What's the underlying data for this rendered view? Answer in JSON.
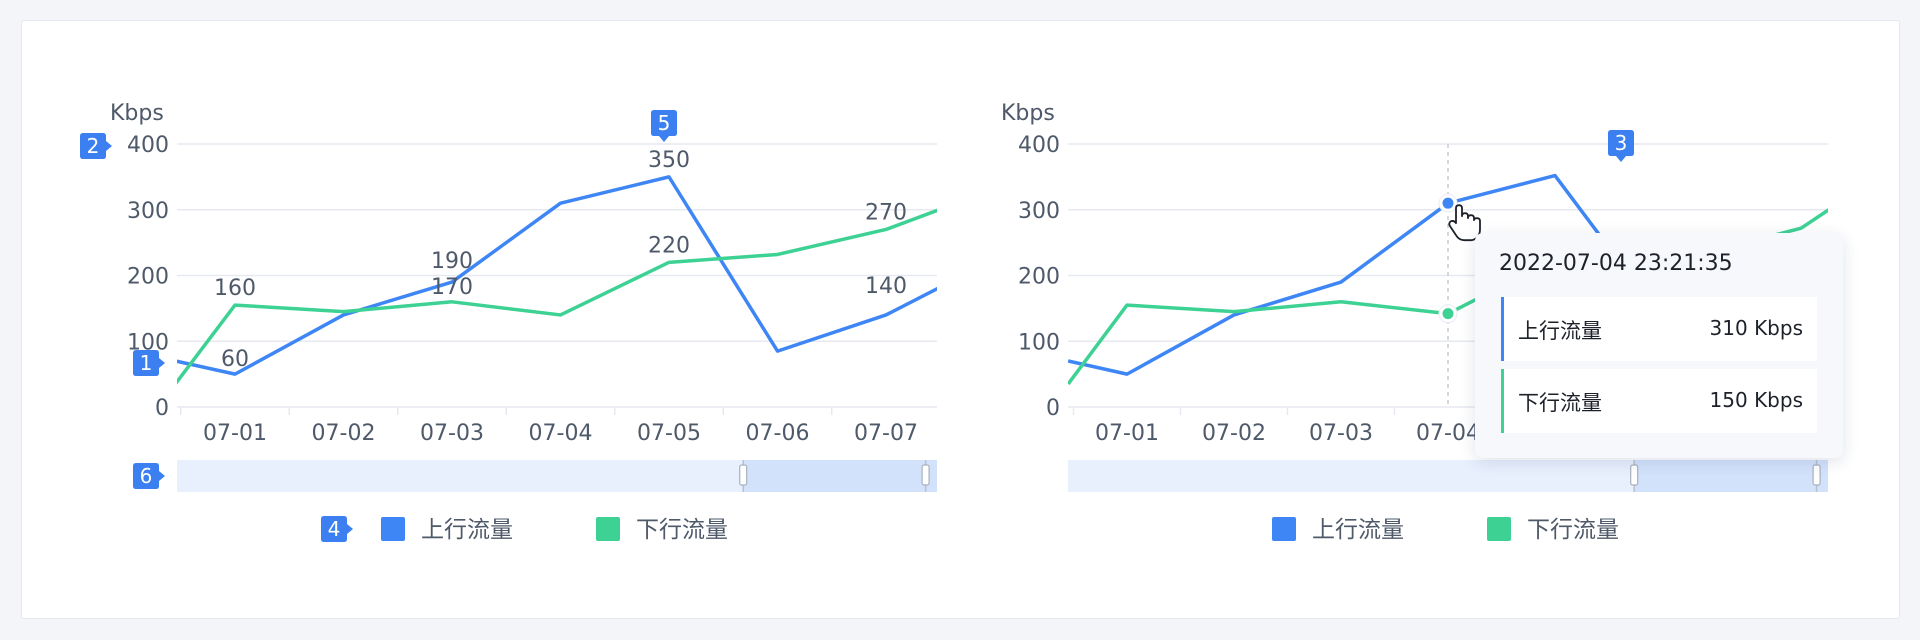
{
  "colors": {
    "upstream": "#3e86f5",
    "downstream": "#3dd193",
    "axis_text": "#4e5969",
    "grid": "#e6e9ef",
    "marker": "#3b7ff0",
    "slider_bg": "#e8f0fd",
    "slider_sel": "#d3e2fb"
  },
  "chart_data": [
    {
      "type": "line",
      "ylabel": "Kbps",
      "ylim": [
        0,
        400
      ],
      "yticks": [
        "0",
        "100",
        "200",
        "300",
        "400"
      ],
      "categories": [
        "07-01",
        "07-02",
        "07-03",
        "07-04",
        "07-05",
        "07-06",
        "07-07"
      ],
      "x_extent": [
        0.45,
        7.65
      ],
      "series": [
        {
          "name": "上行流量",
          "color": "#3e86f5",
          "points": [
            [
              0.45,
              70
            ],
            [
              1,
              50
            ],
            [
              2,
              140
            ],
            [
              3,
              190
            ],
            [
              4,
              310
            ],
            [
              5,
              350
            ],
            [
              6,
              85
            ],
            [
              7,
              140
            ],
            [
              7.65,
              195
            ]
          ]
        },
        {
          "name": "下行流量",
          "color": "#3dd193",
          "points": [
            [
              0.45,
              35
            ],
            [
              1,
              155
            ],
            [
              2,
              145
            ],
            [
              3,
              160
            ],
            [
              4,
              140
            ],
            [
              5,
              220
            ],
            [
              6,
              232
            ],
            [
              7,
              270
            ],
            [
              7.65,
              310
            ]
          ]
        }
      ],
      "data_labels": [
        {
          "x": 1,
          "y": 50,
          "text": "60",
          "dy": -2
        },
        {
          "x": 1,
          "y": 155,
          "text": "160",
          "dy": -4
        },
        {
          "x": 3,
          "y": 190,
          "text": "190",
          "dy": -8
        },
        {
          "x": 3,
          "y": 160,
          "text": "170",
          "dy": -2
        },
        {
          "x": 5,
          "y": 350,
          "text": "350",
          "dy": -4
        },
        {
          "x": 5,
          "y": 220,
          "text": "220",
          "dy": -4
        },
        {
          "x": 7,
          "y": 270,
          "text": "270",
          "dy": -4
        },
        {
          "x": 7,
          "y": 140,
          "text": "140",
          "dy": -16
        }
      ],
      "zoom": {
        "start": 0.745,
        "end": 0.985
      },
      "legend": [
        "上行流量",
        "下行流量"
      ],
      "legend_position": "bottom",
      "markers": [
        "1",
        "2",
        "4",
        "5",
        "6"
      ]
    },
    {
      "type": "line",
      "ylabel": "Kbps",
      "ylim": [
        0,
        400
      ],
      "yticks": [
        "0",
        "100",
        "200",
        "300",
        "400"
      ],
      "categories": [
        "07-01",
        "07-02",
        "07-03",
        "07-04"
      ],
      "x_extent": [
        0.45,
        7.65
      ],
      "series": [
        {
          "name": "上行流量",
          "color": "#3e86f5",
          "points": [
            [
              0.45,
              70
            ],
            [
              1,
              50
            ],
            [
              2,
              140
            ],
            [
              3,
              190
            ],
            [
              4,
              310
            ],
            [
              5,
              352
            ],
            [
              5.7,
              200
            ]
          ]
        },
        {
          "name": "下行流量",
          "color": "#3dd193",
          "points": [
            [
              0.45,
              35
            ],
            [
              1,
              155
            ],
            [
              2,
              145
            ],
            [
              3,
              160
            ],
            [
              4,
              142
            ],
            [
              4.4,
              175
            ]
          ]
        },
        {
          "name": "下行流量",
          "color": "#3dd193",
          "points": [
            [
              6.9,
              255
            ],
            [
              7.3,
              272
            ],
            [
              7.65,
              310
            ]
          ]
        }
      ],
      "hover": {
        "x": 4,
        "upstream": 310,
        "downstream": 142
      },
      "zoom": {
        "start": 0.745,
        "end": 0.985
      },
      "legend": [
        "上行流量",
        "下行流量"
      ],
      "legend_position": "bottom",
      "markers": [
        "3"
      ]
    }
  ],
  "tooltip": {
    "title": "2022-07-04 23:21:35",
    "rows": [
      {
        "name": "上行流量",
        "value": "310 Kbps"
      },
      {
        "name": "下行流量",
        "value": "150 Kbps"
      }
    ]
  }
}
